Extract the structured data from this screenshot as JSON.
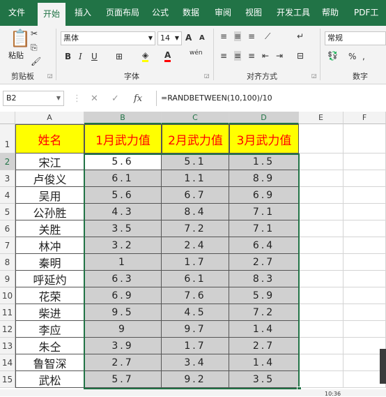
{
  "ribbon_tabs": [
    "文件",
    "开始",
    "插入",
    "页面布局",
    "公式",
    "数据",
    "审阅",
    "视图",
    "开发工具",
    "帮助",
    "PDF工具"
  ],
  "active_tab": "开始",
  "clipboard": {
    "paste_label": "粘贴",
    "group_label": "剪贴板"
  },
  "font": {
    "name": "黑体",
    "size": "14",
    "group_label": "字体",
    "bold": "B",
    "italic": "I",
    "underline": "U",
    "grow": "A",
    "shrink": "A",
    "phonetic": "wén"
  },
  "alignment": {
    "group_label": "对齐方式"
  },
  "number": {
    "format": "常规",
    "group_label": "数字",
    "percent": "%"
  },
  "formula_bar": {
    "name_box": "B2",
    "fx": "fx",
    "formula": "=RANDBETWEEN(10,100)/10"
  },
  "columns": [
    "A",
    "B",
    "C",
    "D",
    "E",
    "F"
  ],
  "selected_columns": [
    "B",
    "C",
    "D"
  ],
  "table": {
    "headers": [
      "姓名",
      "1月武力值",
      "2月武力值",
      "3月武力值"
    ],
    "rows": [
      [
        "宋江",
        "5.6",
        "5.1",
        "1.5"
      ],
      [
        "卢俊义",
        "6.1",
        "1.1",
        "8.9"
      ],
      [
        "吴用",
        "5.6",
        "6.7",
        "6.9"
      ],
      [
        "公孙胜",
        "4.3",
        "8.4",
        "7.1"
      ],
      [
        "关胜",
        "3.5",
        "7.2",
        "7.1"
      ],
      [
        "林冲",
        "3.2",
        "2.4",
        "6.4"
      ],
      [
        "秦明",
        "1",
        "1.7",
        "2.7"
      ],
      [
        "呼延灼",
        "6.3",
        "6.1",
        "8.3"
      ],
      [
        "花荣",
        "6.9",
        "7.6",
        "5.9"
      ],
      [
        "柴进",
        "9.5",
        "4.5",
        "7.2"
      ],
      [
        "李应",
        "9",
        "9.7",
        "1.4"
      ],
      [
        "朱仝",
        "3.9",
        "1.7",
        "2.7"
      ],
      [
        "鲁智深",
        "2.7",
        "3.4",
        "1.4"
      ],
      [
        "武松",
        "5.7",
        "9.2",
        "3.5"
      ]
    ]
  },
  "row_numbers": [
    "1",
    "2",
    "3",
    "4",
    "5",
    "6",
    "7",
    "8",
    "9",
    "10",
    "11",
    "12",
    "13",
    "14",
    "15"
  ],
  "status_clock": "10:36",
  "colors": {
    "excel_green": "#217346",
    "header_fill": "#ffff00",
    "header_text": "#ff0000",
    "selection_fill": "#d0d0d0"
  }
}
